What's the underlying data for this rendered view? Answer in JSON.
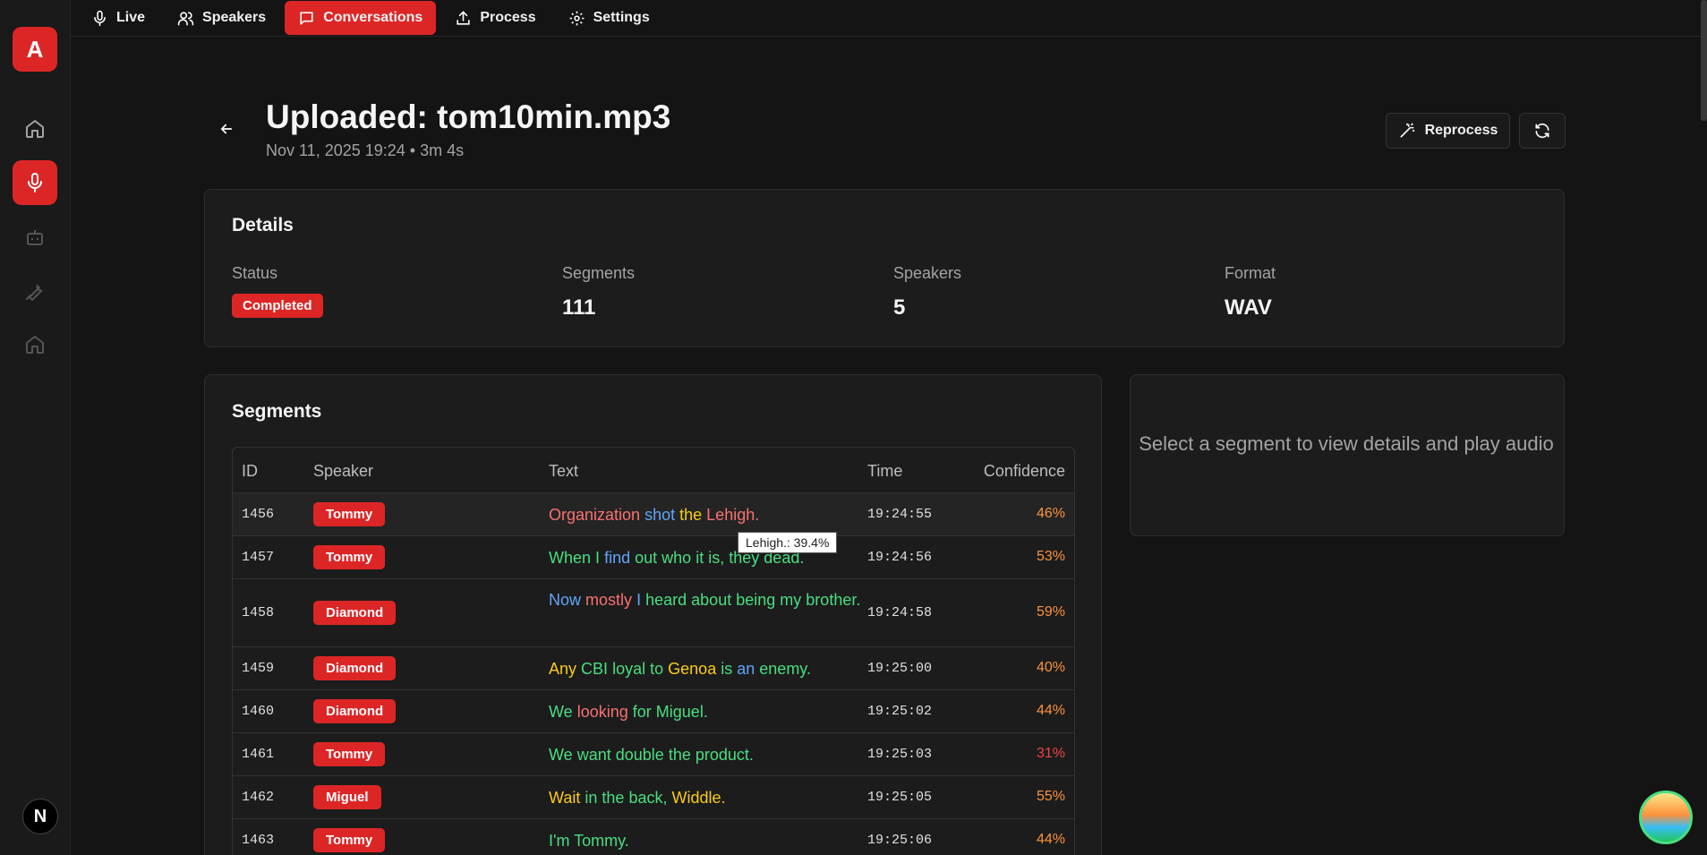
{
  "app": {
    "logo_letter": "A",
    "framework_badge": "N"
  },
  "nav": {
    "items": [
      {
        "label": "Live",
        "icon": "mic-icon"
      },
      {
        "label": "Speakers",
        "icon": "users-icon"
      },
      {
        "label": "Conversations",
        "icon": "message-icon"
      },
      {
        "label": "Process",
        "icon": "upload-icon"
      },
      {
        "label": "Settings",
        "icon": "gear-icon"
      }
    ],
    "active": "Conversations"
  },
  "header": {
    "title": "Uploaded: tom10min.mp3",
    "subtitle": "Nov 11, 2025 19:24 • 3m 4s",
    "reprocess_label": "Reprocess"
  },
  "details": {
    "title": "Details",
    "status_label": "Status",
    "status_value": "Completed",
    "segments_label": "Segments",
    "segments_value": "111",
    "speakers_label": "Speakers",
    "speakers_value": "5",
    "format_label": "Format",
    "format_value": "WAV"
  },
  "segments": {
    "title": "Segments",
    "columns": [
      "ID",
      "Speaker",
      "Text",
      "Time",
      "Confidence"
    ],
    "rows": [
      {
        "id": "1456",
        "speaker": "Tommy",
        "time": "19:24:55",
        "confidence": "46%",
        "conf_color": "#fb923c",
        "words": [
          [
            "Organization",
            "red"
          ],
          [
            "shot",
            "blue"
          ],
          [
            "the",
            "yel"
          ],
          [
            "Lehigh.",
            "red"
          ]
        ]
      },
      {
        "id": "1457",
        "speaker": "Tommy",
        "time": "19:24:56",
        "confidence": "53%",
        "conf_color": "#fb923c",
        "words": [
          [
            "When",
            "grn"
          ],
          [
            "I",
            "grn"
          ],
          [
            "find",
            "blue"
          ],
          [
            "out",
            "grn"
          ],
          [
            "who",
            "grn"
          ],
          [
            "it",
            "grn"
          ],
          [
            "is,",
            "grn"
          ],
          [
            "they",
            "grn"
          ],
          [
            "dead.",
            "grn"
          ]
        ]
      },
      {
        "id": "1458",
        "speaker": "Diamond",
        "time": "19:24:58",
        "confidence": "59%",
        "conf_color": "#fb923c",
        "words": [
          [
            "Now",
            "blue"
          ],
          [
            "mostly",
            "red"
          ],
          [
            "I",
            "blue"
          ],
          [
            "heard",
            "grn"
          ],
          [
            "about",
            "grn"
          ],
          [
            "being",
            "grn"
          ],
          [
            "my",
            "grn"
          ],
          [
            "brother.",
            "grn"
          ]
        ]
      },
      {
        "id": "1459",
        "speaker": "Diamond",
        "time": "19:25:00",
        "confidence": "40%",
        "conf_color": "#fb923c",
        "words": [
          [
            "Any",
            "yel"
          ],
          [
            "CBI",
            "grn"
          ],
          [
            "loyal",
            "grn"
          ],
          [
            "to",
            "grn"
          ],
          [
            "Genoa",
            "yel"
          ],
          [
            "is",
            "grn"
          ],
          [
            "an",
            "blue"
          ],
          [
            "enemy.",
            "grn"
          ]
        ]
      },
      {
        "id": "1460",
        "speaker": "Diamond",
        "time": "19:25:02",
        "confidence": "44%",
        "conf_color": "#fb923c",
        "words": [
          [
            "We",
            "grn"
          ],
          [
            "looking",
            "red"
          ],
          [
            "for",
            "grn"
          ],
          [
            "Miguel.",
            "grn"
          ]
        ]
      },
      {
        "id": "1461",
        "speaker": "Tommy",
        "time": "19:25:03",
        "confidence": "31%",
        "conf_color": "#ef4444",
        "words": [
          [
            "We",
            "grn"
          ],
          [
            "want",
            "grn"
          ],
          [
            "double",
            "grn"
          ],
          [
            "the",
            "grn"
          ],
          [
            "product.",
            "grn"
          ]
        ]
      },
      {
        "id": "1462",
        "speaker": "Miguel",
        "time": "19:25:05",
        "confidence": "55%",
        "conf_color": "#fb923c",
        "words": [
          [
            "Wait",
            "yel"
          ],
          [
            "in",
            "grn"
          ],
          [
            "the",
            "grn"
          ],
          [
            "back,",
            "grn"
          ],
          [
            "Widdle.",
            "yel"
          ]
        ]
      },
      {
        "id": "1463",
        "speaker": "Tommy",
        "time": "19:25:06",
        "confidence": "44%",
        "conf_color": "#fb923c",
        "words": [
          [
            "I'm",
            "grn"
          ],
          [
            "Tommy.",
            "grn"
          ]
        ]
      }
    ]
  },
  "tooltip": "Lehigh.: 39.4%",
  "side_panel": {
    "message": "Select a segment to view details and play audio"
  }
}
